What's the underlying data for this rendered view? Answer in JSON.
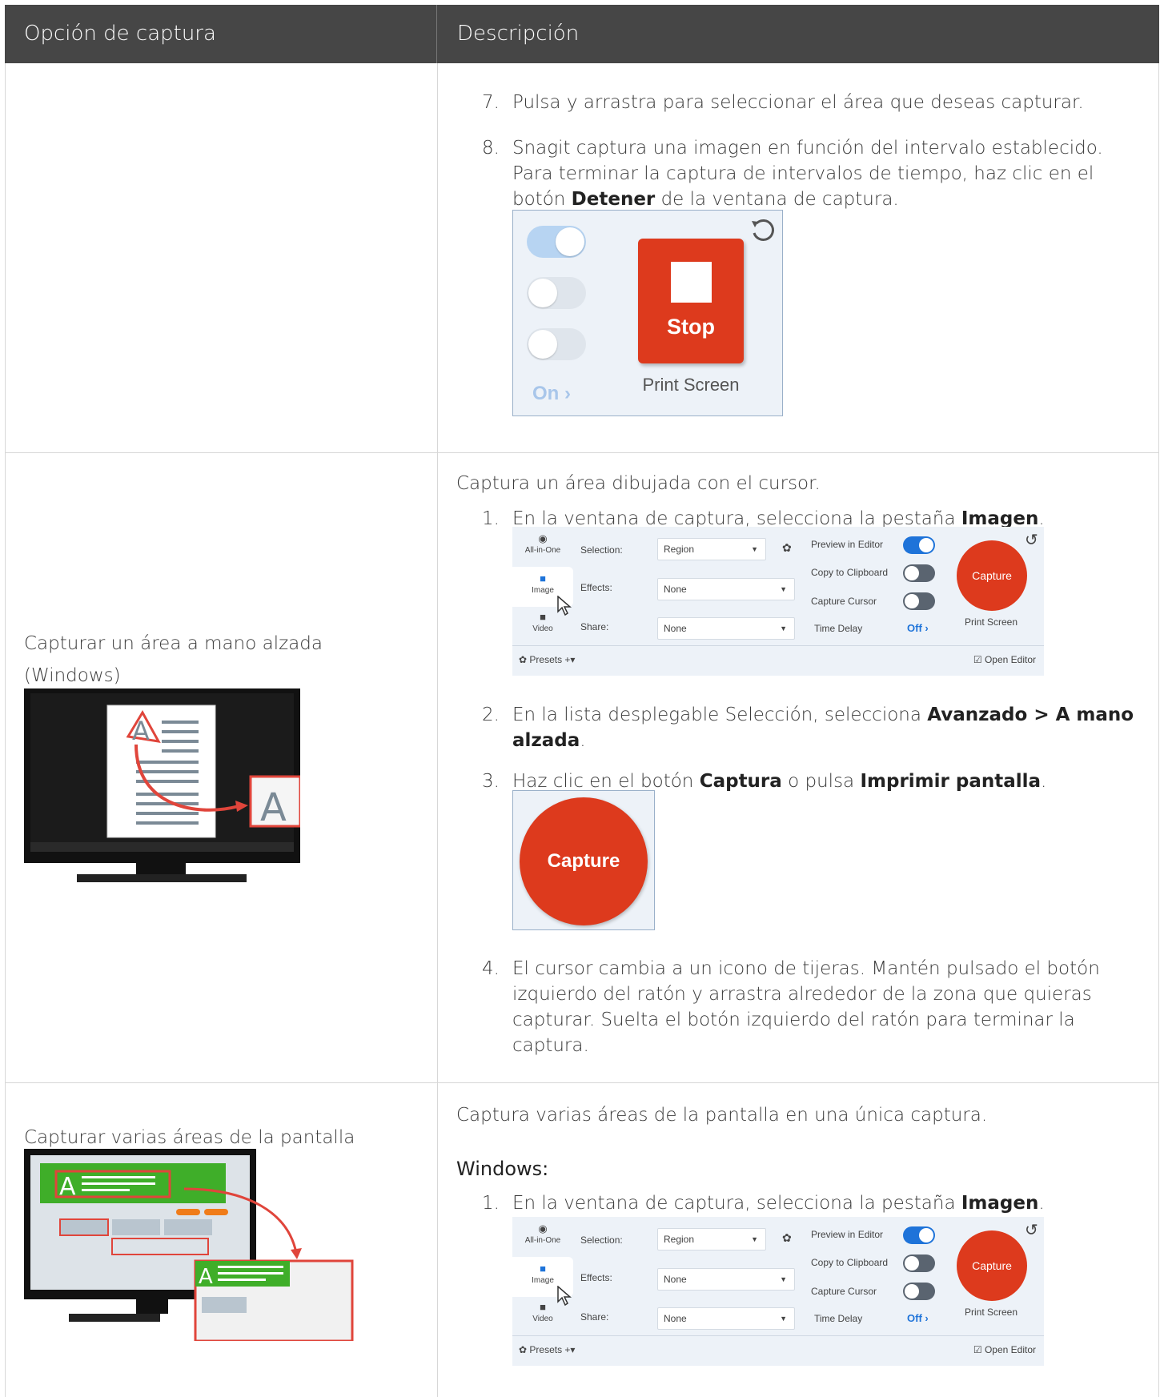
{
  "table": {
    "header": {
      "col1": "Opción de captura",
      "col2": "Descripción"
    }
  },
  "row1": {
    "step7_num": "7.",
    "step7": "Pulsa y arrastra para seleccionar el área que deseas capturar.",
    "step8_num": "8.",
    "step8_line1": "Snagit captura una imagen en función del intervalo establecido.",
    "step8_line2": "Para terminar la captura de intervalos de tiempo, haz clic en el",
    "step8_line3a": "botón ",
    "step8_line3b": "Detener",
    "step8_line3c": " de la ventana de captura.",
    "panel": {
      "stop": "Stop",
      "print_screen": "Print Screen",
      "on": "On ›"
    }
  },
  "row2": {
    "option_line1": "Capturar un área a mano alzada",
    "option_line2": "(Windows)",
    "intro": "Captura un área dibujada con el cursor.",
    "s1_num": "1.",
    "s1a": "En la ventana de captura, selecciona la pestaña ",
    "s1b": "Imagen",
    "s1c": ".",
    "s2_num": "2.",
    "s2a": "En la lista desplegable Selección, selecciona ",
    "s2b": "Avanzado > A mano",
    "s2c": "alzada",
    "s2d": ".",
    "s3_num": "3.",
    "s3a": "Haz clic en el botón ",
    "s3b": "Captura",
    "s3c": " o pulsa ",
    "s3d": "Imprimir pantalla",
    "s3e": ".",
    "capture_big": "Capture",
    "s4_num": "4.",
    "s4_line1": "El cursor cambia a un icono de tijeras. Mantén pulsado el botón",
    "s4_line2": "izquierdo del ratón y arrastra alrededor de la zona que quieras",
    "s4_line3": "capturar. Suelta el botón izquierdo del ratón para terminar la",
    "s4_line4": "captura."
  },
  "row3": {
    "option": "Capturar varias áreas de la pantalla",
    "intro": "Captura varias áreas de la pantalla en una única captura.",
    "heading": "Windows:",
    "s1_num": "1.",
    "s1a": "En la ventana de captura, selecciona la pestaña ",
    "s1b": "Imagen",
    "s1c": "."
  },
  "capture_panel": {
    "tabs": [
      "All-in-One",
      "Image",
      "Video"
    ],
    "selection_label": "Selection:",
    "selection_value": "Region",
    "effects_label": "Effects:",
    "effects_value": "None",
    "share_label": "Share:",
    "share_value": "None",
    "preview": "Preview in Editor",
    "clipboard": "Copy to Clipboard",
    "cursor": "Capture Cursor",
    "delay": "Time Delay",
    "delay_value": "Off ›",
    "capture": "Capture",
    "print_screen": "Print Screen",
    "presets": "Presets",
    "plus": "+▾",
    "open_editor": "Open Editor"
  },
  "colors": {
    "header_bg": "#464646",
    "accent_red": "#dd3a1d",
    "toggle_blue": "#1e73d9",
    "panel_bg": "#edf2f8"
  }
}
